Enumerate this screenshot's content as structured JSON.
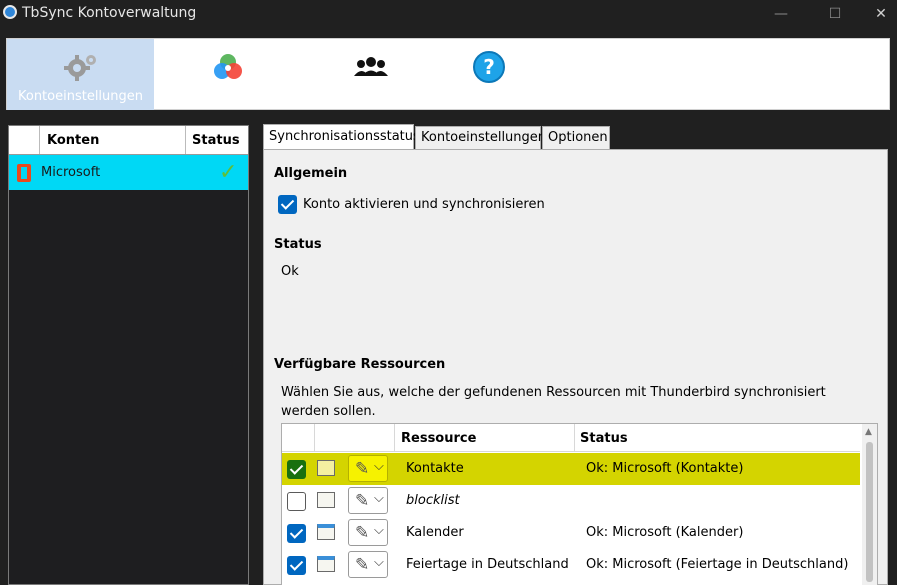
{
  "window": {
    "title": "TbSync Kontoverwaltung",
    "controls": {
      "minimize": "—",
      "maximize": "☐",
      "close": "✕"
    }
  },
  "toolbar": {
    "items": [
      {
        "label": "Kontoeinstellungen",
        "icon": "gears-icon"
      },
      {
        "label": "",
        "icon": "color-circles-icon"
      },
      {
        "label": "",
        "icon": "users-icon"
      },
      {
        "label": "",
        "icon": "help-icon"
      }
    ]
  },
  "accounts": {
    "header_konten": "Konten",
    "header_status": "Status",
    "rows": [
      {
        "name": "Microsoft",
        "status_icon": "✓"
      }
    ]
  },
  "tabs": [
    "Synchronisationsstatus",
    "Kontoeinstellungen",
    "Optionen"
  ],
  "general": {
    "heading": "Allgemein",
    "activate_label": "Konto aktivieren und synchronisieren",
    "activate_checked": true
  },
  "status": {
    "heading": "Status",
    "value": "Ok"
  },
  "resources": {
    "heading": "Verfügbare Ressourcen",
    "description": "Wählen Sie aus, welche der gefundenen Ressourcen mit Thunderbird synchronisiert werden sollen.",
    "col_resource": "Ressource",
    "col_status": "Status",
    "rows": [
      {
        "name": "Kontakte",
        "status": "Ok: Microsoft (Kontakte)",
        "checked": true,
        "selected": true,
        "italic": false
      },
      {
        "name": "blocklist",
        "status": "",
        "checked": false,
        "selected": false,
        "italic": true
      },
      {
        "name": "Kalender",
        "status": "Ok: Microsoft (Kalender)",
        "checked": true,
        "selected": false,
        "italic": false
      },
      {
        "name": "Feiertage in Deutschland",
        "status": "Ok: Microsoft (Feiertage in Deutschland)",
        "checked": true,
        "selected": false,
        "italic": false
      }
    ]
  },
  "colors": {
    "selection_row": "#d4d400",
    "account_selected": "#00d8f5",
    "checkbox": "#0067c0"
  }
}
